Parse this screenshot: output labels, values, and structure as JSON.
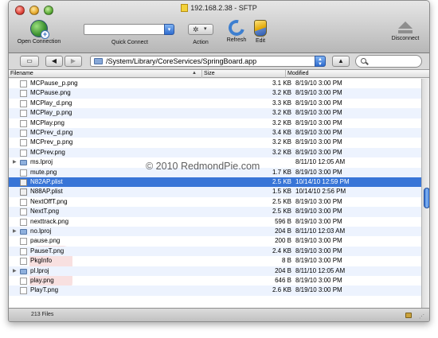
{
  "window": {
    "title": "192.168.2.38 - SFTP"
  },
  "toolbar": {
    "open_connection": "Open Connection",
    "quick_connect": "Quick Connect",
    "quick_connect_value": "",
    "action": "Action",
    "refresh": "Refresh",
    "edit": "Edit",
    "disconnect": "Disconnect"
  },
  "pathbar": {
    "path": "/System/Library/CoreServices/SpringBoard.app",
    "search_value": ""
  },
  "columns": {
    "filename": "Filename",
    "size": "Size",
    "modified": "Modified"
  },
  "files": [
    {
      "name": "MCPause_p.png",
      "size": "3.1 KB",
      "modified": "8/19/10 3:00 PM",
      "type": "file"
    },
    {
      "name": "MCPause.png",
      "size": "3.2 KB",
      "modified": "8/19/10 3:00 PM",
      "type": "file"
    },
    {
      "name": "MCPlay_d.png",
      "size": "3.3 KB",
      "modified": "8/19/10 3:00 PM",
      "type": "file"
    },
    {
      "name": "MCPlay_p.png",
      "size": "3.2 KB",
      "modified": "8/19/10 3:00 PM",
      "type": "file"
    },
    {
      "name": "MCPlay.png",
      "size": "3.2 KB",
      "modified": "8/19/10 3:00 PM",
      "type": "file"
    },
    {
      "name": "MCPrev_d.png",
      "size": "3.4 KB",
      "modified": "8/19/10 3:00 PM",
      "type": "file"
    },
    {
      "name": "MCPrev_p.png",
      "size": "3.2 KB",
      "modified": "8/19/10 3:00 PM",
      "type": "file"
    },
    {
      "name": "MCPrev.png",
      "size": "3.2 KB",
      "modified": "8/19/10 3:00 PM",
      "type": "file"
    },
    {
      "name": "ms.lproj",
      "size": "",
      "modified": "8/11/10 12:05 AM",
      "type": "folder"
    },
    {
      "name": "mute.png",
      "size": "1.7 KB",
      "modified": "8/19/10 3:00 PM",
      "type": "file"
    },
    {
      "name": "N82AP.plist",
      "size": "2.5 KB",
      "modified": "10/14/10 12:59 PM",
      "type": "plist",
      "selected": true
    },
    {
      "name": "N88AP.plist",
      "size": "1.5 KB",
      "modified": "10/14/10 2:56 PM",
      "type": "plist"
    },
    {
      "name": "NextOffT.png",
      "size": "2.5 KB",
      "modified": "8/19/10 3:00 PM",
      "type": "file"
    },
    {
      "name": "NextT.png",
      "size": "2.5 KB",
      "modified": "8/19/10 3:00 PM",
      "type": "file"
    },
    {
      "name": "nexttrack.png",
      "size": "596 B",
      "modified": "8/19/10 3:00 PM",
      "type": "file"
    },
    {
      "name": "no.lproj",
      "size": "204 B",
      "modified": "8/11/10 12:03 AM",
      "type": "folder"
    },
    {
      "name": "pause.png",
      "size": "200 B",
      "modified": "8/19/10 3:00 PM",
      "type": "file"
    },
    {
      "name": "PauseT.png",
      "size": "2.4 KB",
      "modified": "8/19/10 3:00 PM",
      "type": "file"
    },
    {
      "name": "PkgInfo",
      "size": "8 B",
      "modified": "8/19/10 3:00 PM",
      "type": "file"
    },
    {
      "name": "pl.lproj",
      "size": "204 B",
      "modified": "8/11/10 12:05 AM",
      "type": "folder"
    },
    {
      "name": "play.png",
      "size": "646 B",
      "modified": "8/19/10 3:00 PM",
      "type": "file"
    },
    {
      "name": "PlayT.png",
      "size": "2.6 KB",
      "modified": "8/19/10 3:00 PM",
      "type": "file"
    }
  ],
  "status": {
    "file_count": "213 Files"
  },
  "watermark": "© 2010 RedmondPie.com",
  "colors": {
    "selection": "#3875d7",
    "alt_row": "#edf3fe",
    "scroll_thumb": "#2e6ad0"
  }
}
